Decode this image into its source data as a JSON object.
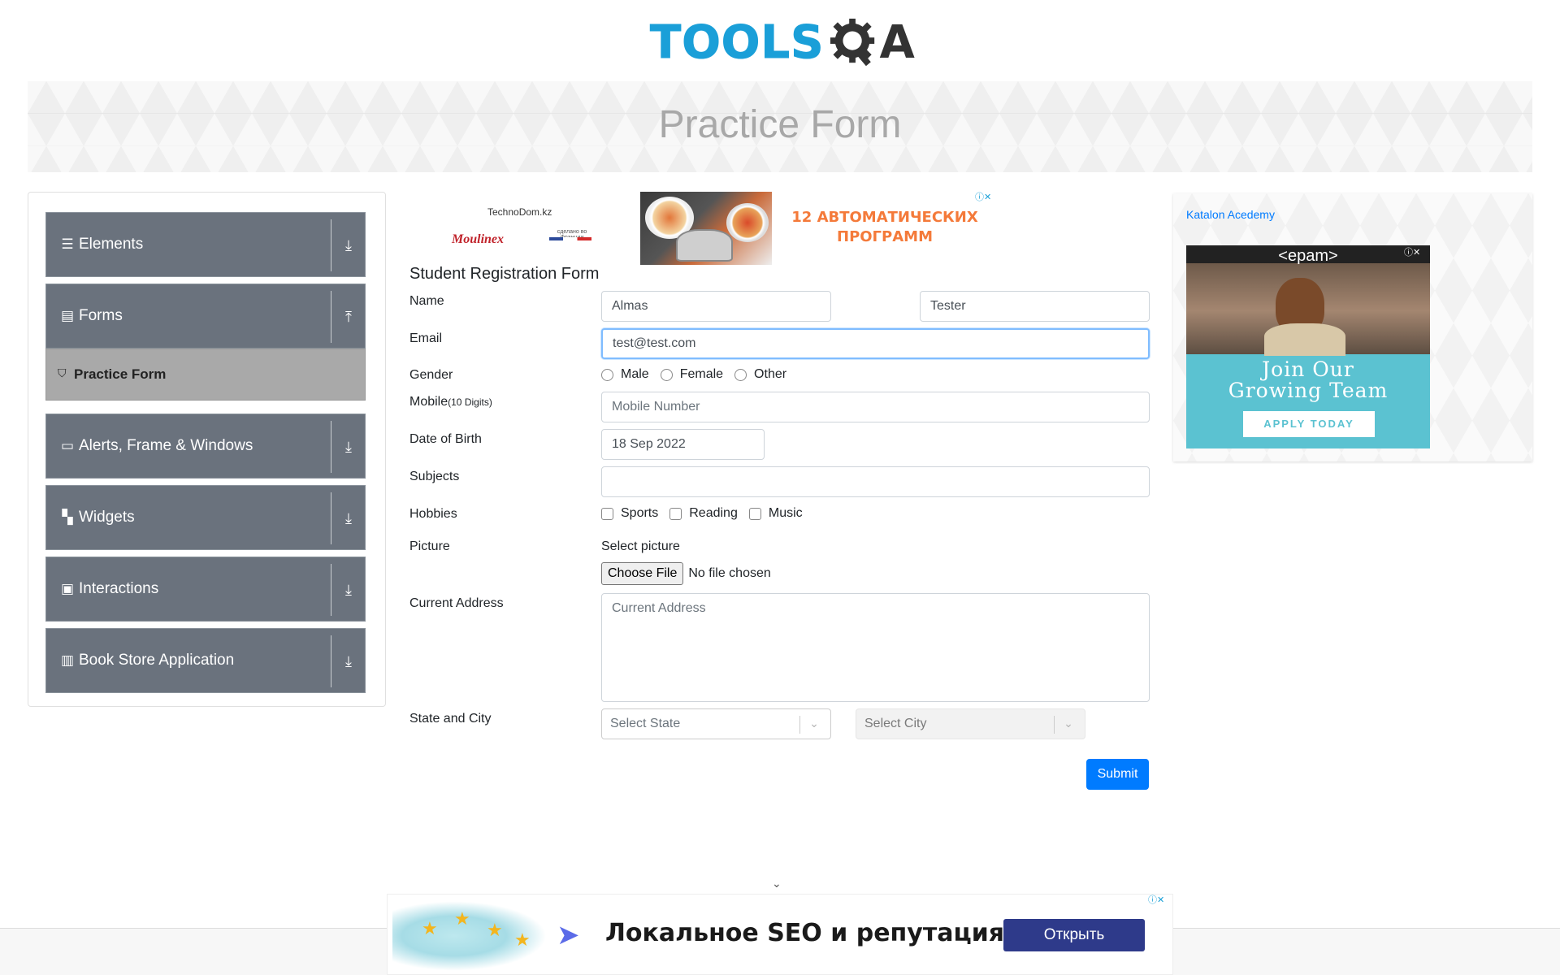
{
  "header": {
    "logo_text": "TOOLS",
    "logo_a": "A"
  },
  "banner": {
    "title": "Practice Form"
  },
  "sidebar": {
    "groups": [
      {
        "label": "Elements",
        "icon": "menu-icon",
        "arrow": "download-icon"
      },
      {
        "label": "Forms",
        "icon": "document-icon",
        "arrow": "upload-icon"
      },
      {
        "label": "Alerts, Frame & Windows",
        "icon": "window-icon",
        "arrow": "download-icon"
      },
      {
        "label": "Widgets",
        "icon": "widgets-icon",
        "arrow": "download-icon"
      },
      {
        "label": "Interactions",
        "icon": "interactions-icon",
        "arrow": "download-icon"
      },
      {
        "label": "Book Store Application",
        "icon": "books-icon",
        "arrow": "download-icon"
      }
    ],
    "active_item": {
      "label": "Practice Form",
      "icon": "html5-icon"
    }
  },
  "top_ad": {
    "brand1": "TechnoDom.kz",
    "brand2": "Moulinex",
    "brand3": "сделано во Франции",
    "promo": "12 АВТОМАТИЧЕСКИХ ПРОГРАММ"
  },
  "form": {
    "title": "Student Registration Form",
    "labels": {
      "name": "Name",
      "email": "Email",
      "gender": "Gender",
      "mobile": "Mobile",
      "mobile_hint": "(10 Digits)",
      "dob": "Date of Birth",
      "subjects": "Subjects",
      "hobbies": "Hobbies",
      "picture": "Picture",
      "address": "Current Address",
      "state_city": "State and City"
    },
    "first_name": "Almas",
    "last_name": "Tester",
    "email": "test@test.com",
    "genders": [
      "Male",
      "Female",
      "Other"
    ],
    "mobile_placeholder": "Mobile Number",
    "dob": "18 Sep 2022",
    "subjects": "",
    "hobbies": [
      "Sports",
      "Reading",
      "Music"
    ],
    "picture_label": "Select picture",
    "file_button": "Choose File",
    "file_status": "No file chosen",
    "address_placeholder": "Current Address",
    "state_placeholder": "Select State",
    "city_placeholder": "Select City",
    "submit": "Submit"
  },
  "right_ad": {
    "katalon": "Katalon Acedemy",
    "epam_logo": "<epam>",
    "headline_line1": "Join Our",
    "headline_line2": "Growing Team",
    "cta": "APPLY TODAY"
  },
  "bottom_ad": {
    "text": "Локальное SEO и репутация",
    "button": "Открыть"
  }
}
